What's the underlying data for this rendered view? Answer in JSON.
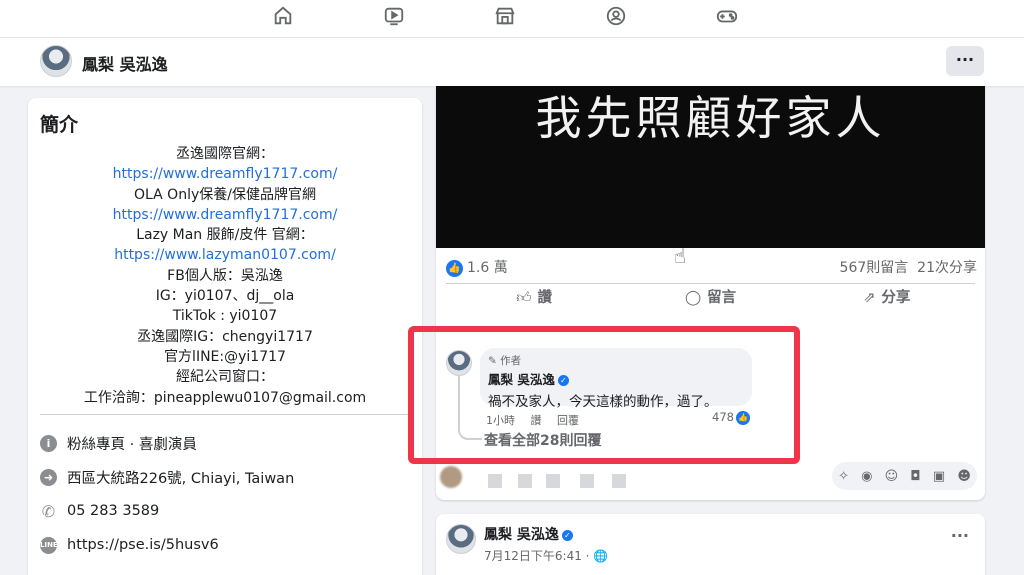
{
  "topnav": {
    "icons": [
      "home-icon",
      "video-icon",
      "marketplace-icon",
      "groups-icon",
      "gaming-icon"
    ]
  },
  "profile": {
    "name": "鳳梨 吳泓逸",
    "more_label": "···"
  },
  "intro": {
    "title": "簡介",
    "bio_lines": [
      {
        "text": "丞逸國際官網：",
        "link": false
      },
      {
        "text": "https://www.dreamfly1717.com/",
        "link": true
      },
      {
        "text": "OLA Only保養/保健品牌官網",
        "link": false
      },
      {
        "text": "https://www.dreamfly1717.com/",
        "link": true
      },
      {
        "text": "Lazy Man 服飾/皮件 官網：",
        "link": false
      },
      {
        "text": "https://www.lazyman0107.com/",
        "link": true
      },
      {
        "text": "FB個人版：吳泓逸",
        "link": false
      },
      {
        "text": "IG：yi0107、dj__ola",
        "link": false
      },
      {
        "text": "TikTok : yi0107",
        "link": false
      },
      {
        "text": "丞逸國際IG：chengyi1717",
        "link": false
      },
      {
        "text": "官方lINE:@yi1717",
        "link": false
      },
      {
        "text": "經紀公司窗口：",
        "link": false
      },
      {
        "text": "工作洽詢：pineapplewu0107@gmail.com",
        "link": false
      }
    ],
    "info": [
      {
        "icon": "info-icon",
        "text": "粉絲專頁 · 喜劇演員"
      },
      {
        "icon": "location-icon",
        "text": "西區大統路226號, Chiayi, Taiwan"
      },
      {
        "icon": "phone-icon",
        "text": "05 283 3589"
      },
      {
        "icon": "line-icon",
        "text": "https://pse.is/5husv6"
      }
    ]
  },
  "post": {
    "video_caption": "我先照顧好家人",
    "likes": "1.6 萬",
    "comments_count": "567則留言",
    "shares_count": "21次分享",
    "actions": {
      "like": "讚",
      "comment": "留言",
      "share": "分享"
    },
    "comment": {
      "badge": "作者",
      "author": "鳳梨 吳泓逸",
      "text": "禍不及家人，今天這樣的動作，過了。",
      "time": "1小時",
      "like_label": "讚",
      "reply_label": "回覆",
      "reactions": "478",
      "view_replies": "查看全部28則回覆"
    }
  },
  "post2": {
    "author": "鳳梨 吳泓逸",
    "date": "7月12日下午6:41 · 🌐",
    "more_label": "···"
  }
}
